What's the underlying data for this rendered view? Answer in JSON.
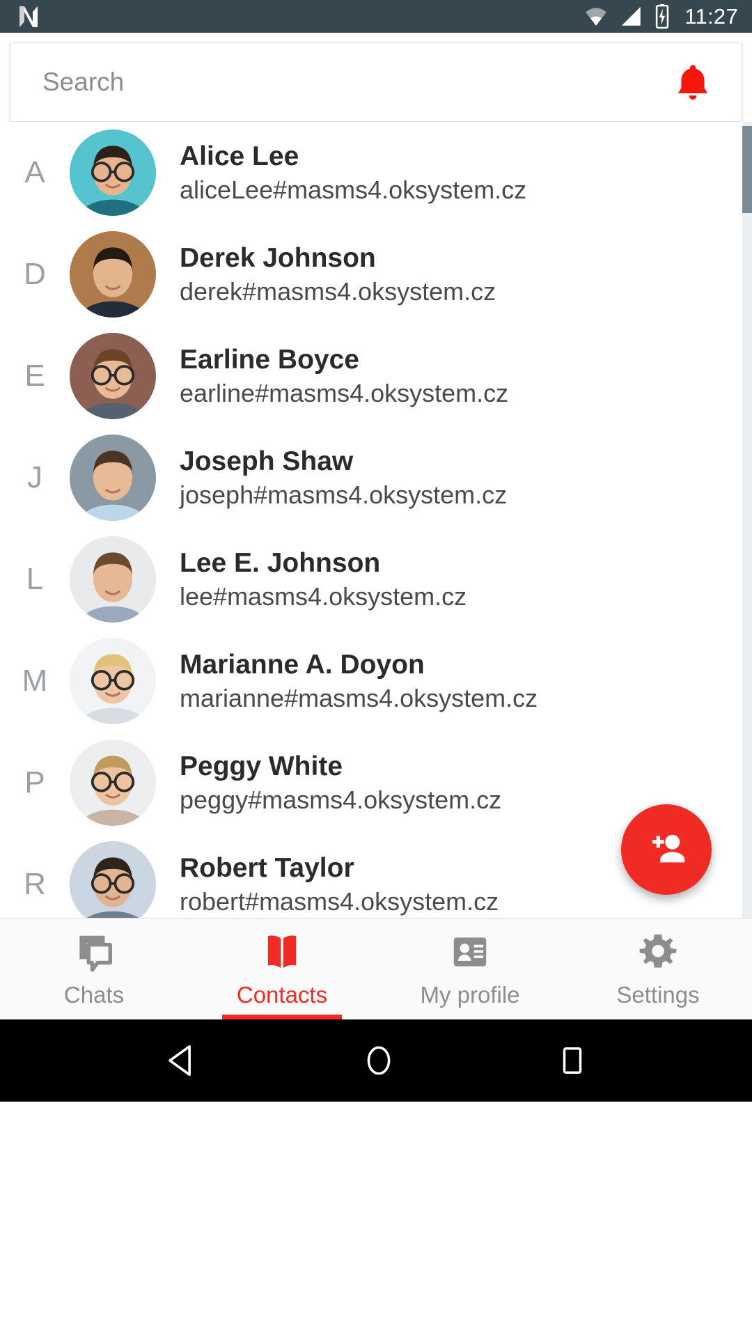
{
  "status_bar": {
    "logo_icon": "android-n-logo",
    "wifi_icon": "wifi-icon",
    "signal_icon": "signal-icon",
    "battery_icon": "battery-charging-icon",
    "time": "11:27"
  },
  "search": {
    "placeholder": "Search",
    "value": "",
    "bell_icon": "bell-icon",
    "bell_color": "#f5170d"
  },
  "contacts": [
    {
      "letter": "A",
      "name": "Alice Lee",
      "id": "aliceLee#masms4.oksystem.cz",
      "avatar": "alice"
    },
    {
      "letter": "D",
      "name": "Derek Johnson",
      "id": "derek#masms4.oksystem.cz",
      "avatar": "derek"
    },
    {
      "letter": "E",
      "name": "Earline Boyce",
      "id": "earline#masms4.oksystem.cz",
      "avatar": "earline"
    },
    {
      "letter": "J",
      "name": "Joseph Shaw",
      "id": "joseph#masms4.oksystem.cz",
      "avatar": "joseph"
    },
    {
      "letter": "L",
      "name": "Lee E. Johnson",
      "id": "lee#masms4.oksystem.cz",
      "avatar": "lee"
    },
    {
      "letter": "M",
      "name": "Marianne A. Doyon",
      "id": "marianne#masms4.oksystem.cz",
      "avatar": "marianne"
    },
    {
      "letter": "P",
      "name": "Peggy White",
      "id": "peggy#masms4.oksystem.cz",
      "avatar": "peggy"
    },
    {
      "letter": "R",
      "name": "Robert Taylor",
      "id": "robert#masms4.oksystem.cz",
      "avatar": "robert"
    }
  ],
  "fab": {
    "icon": "person-add-icon",
    "color": "#f02b23"
  },
  "tabs": [
    {
      "label": "Chats",
      "icon": "chat-bubbles-icon",
      "active": false
    },
    {
      "label": "Contacts",
      "icon": "open-book-icon",
      "active": true
    },
    {
      "label": "My profile",
      "icon": "id-card-icon",
      "active": false
    },
    {
      "label": "Settings",
      "icon": "gear-icon",
      "active": false
    }
  ],
  "nav_bar": {
    "back_icon": "back-triangle-icon",
    "home_icon": "home-circle-icon",
    "recents_icon": "recents-square-icon"
  },
  "theme": {
    "accent": "#ef2b24",
    "status_bar_bg": "#37474f",
    "letter_color": "#9aa0a6"
  }
}
